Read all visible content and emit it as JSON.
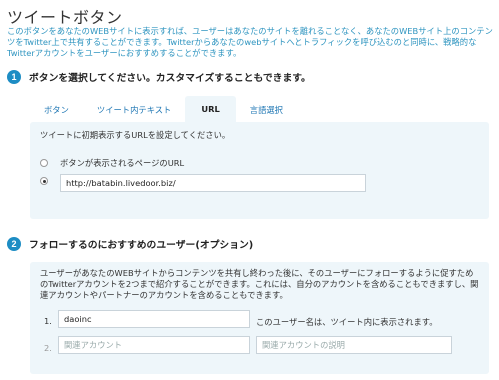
{
  "page": {
    "title": "ツイートボタン",
    "intro": "このボタンをあなたのWEBサイトに表示すれば、ユーザーはあなたのサイトを離れることなく、あなたのWEBサイト上のコンテンツをTwitter上で共有することができます。Twitterからあなたのwebサイトへとトラフィックを呼び込むのと同時に、戦略的なTwitterアカウントをユーザーにおすすめすることができます。"
  },
  "step1": {
    "number": "1",
    "title": "ボタンを選択してください。カスタマイズすることもできます。",
    "tabs": [
      {
        "label": "ボタン",
        "active": false
      },
      {
        "label": "ツイート内テキスト",
        "active": false
      },
      {
        "label": "URL",
        "active": true
      },
      {
        "label": "言語選択",
        "active": false
      }
    ],
    "note": "ツイートに初期表示するURLを設定してください。",
    "options": [
      {
        "label": "ボタンが表示されるページのURL",
        "checked": false
      },
      {
        "value": "http://batabin.livedoor.biz/",
        "checked": true
      }
    ]
  },
  "step2": {
    "number": "2",
    "title": "フォローするのにおすすめのユーザー(オプション)",
    "note": "ユーザーがあなたのWEBサイトからコンテンツを共有し終わった後に、そのユーザーにフォローするように促すためのTwitterアカウントを2つまで紹介することができます。これには、自分のアカウントを含めることもできますし、関連アカウントやパートナーのアカウントを含めることもできます。",
    "rows": [
      {
        "number": "1.",
        "value": "daoinc",
        "hint": "このユーザー名は、ツイート内に表示されます。"
      },
      {
        "number": "2.",
        "account_placeholder": "関連アカウント",
        "description_placeholder": "関連アカウントの説明"
      }
    ]
  }
}
